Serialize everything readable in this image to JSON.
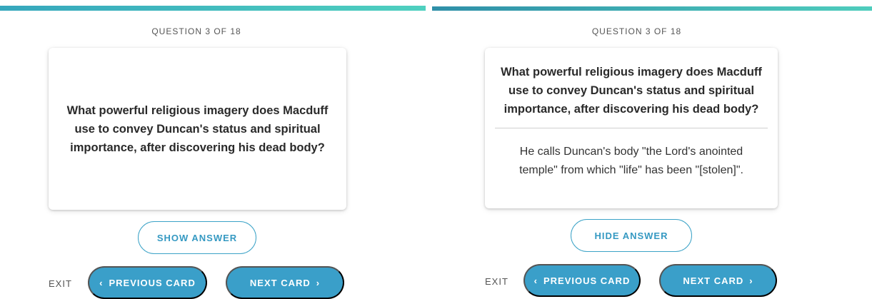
{
  "left_panel": {
    "counter": "QUESTION 3 OF 18",
    "question": "What powerful religious imagery does Macduff use to convey Duncan's status and spiritual importance, after discovering his dead body?",
    "toggle_label": "SHOW ANSWER",
    "exit_label": "EXIT",
    "prev_label": "PREVIOUS CARD",
    "next_label": "NEXT CARD",
    "prev_icon": "‹",
    "next_icon": "›"
  },
  "right_panel": {
    "counter": "QUESTION 3 OF 18",
    "question": "What powerful religious imagery does Macduff use to convey Duncan's status and spiritual importance, after discovering his dead body?",
    "answer": "He calls Duncan's body \"the Lord's anointed temple\" from which \"life\" has been \"[stolen]\".",
    "toggle_label": "HIDE ANSWER",
    "exit_label": "EXIT",
    "prev_label": "PREVIOUS CARD",
    "next_label": "NEXT CARD",
    "prev_icon": "‹",
    "next_icon": "›"
  },
  "colors": {
    "accent": "#3a9fc9",
    "progress_start": "#36a7bd",
    "progress_end": "#4fd0bf"
  }
}
